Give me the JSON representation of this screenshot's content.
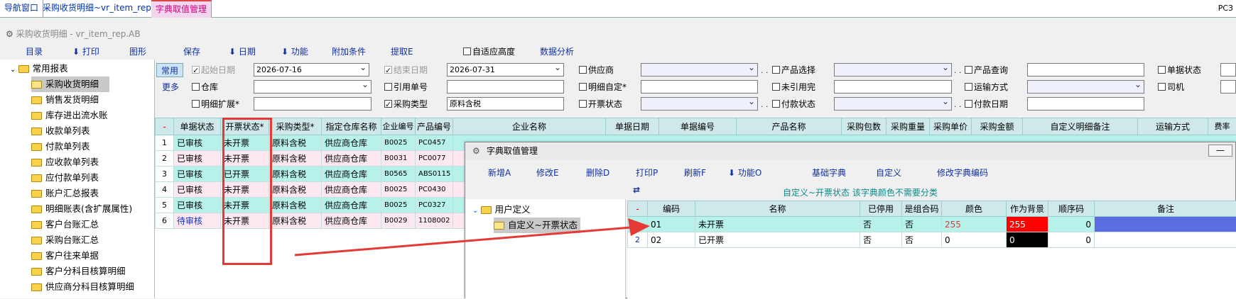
{
  "tabs": [
    {
      "label": "导航窗口"
    },
    {
      "label": "采购收货明细~vr_item_rep.AB"
    },
    {
      "label": "字典取值管理"
    }
  ],
  "pc_id": "PC3",
  "window_title": "采购收货明细 - vr_item_rep.AB",
  "menu": {
    "catalog": "目录",
    "print": "打印",
    "chart": "图形",
    "save": "保存",
    "date": "日期",
    "function": "功能",
    "extra_cond": "附加条件",
    "extract": "提取E",
    "auto_height": "自适应高度",
    "data_analysis": "数据分析"
  },
  "sidebar": {
    "root": "常用报表",
    "items": [
      "采购收货明细",
      "销售发货明细",
      "库存进出流水账",
      "收款单列表",
      "付款单列表",
      "应收款单列表",
      "应付款单列表",
      "账户汇总报表",
      "明细账表(含扩展属性)",
      "客户台账汇总",
      "采购台账汇总",
      "客户往来单据",
      "客户分科目核算明细",
      "供应商分科目核算明细"
    ]
  },
  "filters": {
    "tab_common": "常用",
    "tab_more": "更多",
    "start_date_label": "起始日期",
    "start_date_value": "2026-07-16",
    "end_date_label": "结束日期",
    "end_date_value": "2026-07-31",
    "supplier": "供应商",
    "product_select": "产品选择",
    "product_query": "产品查询",
    "doc_status": "单据状态",
    "warehouse": "仓库",
    "ref_no": "引用单号",
    "detail_custom": "明细自定*",
    "unquoted": "未引用完",
    "ship_method": "运输方式",
    "driver": "司机",
    "detail_ext": "明细扩展*",
    "purchase_type": "采购类型",
    "purchase_type_value": "原料含税",
    "invoice_status": "开票状态",
    "pay_status": "付款状态",
    "pay_date": "付款日期"
  },
  "grid": {
    "headers": [
      "单据状态",
      "开票状态*",
      "采购类型*",
      "指定仓库名称",
      "企业编号",
      "产品编号",
      "企业名称",
      "单据日期",
      "单据编号",
      "产品名称",
      "采购包数",
      "采购重量",
      "采购单价",
      "采购金额",
      "自定义明细备注",
      "运输方式",
      "费率"
    ],
    "rows": [
      [
        "1",
        "已审核",
        "未开票",
        "原料含税",
        "供应商仓库",
        "B0025",
        "PC0457"
      ],
      [
        "2",
        "已审核",
        "未开票",
        "原料含税",
        "供应商仓库",
        "B0031",
        "PC0077"
      ],
      [
        "3",
        "已审核",
        "已开票",
        "原料含税",
        "供应商仓库",
        "B0565",
        "ABS0115"
      ],
      [
        "4",
        "已审核",
        "未开票",
        "原料含税",
        "供应商仓库",
        "B0025",
        "PC0430"
      ],
      [
        "5",
        "已审核",
        "未开票",
        "原料含税",
        "供应商仓库",
        "B0025",
        "PC0327"
      ],
      [
        "6",
        "待审核",
        "未开票",
        "原料含税",
        "供应商仓库",
        "B0029",
        "1108002"
      ]
    ]
  },
  "dialog": {
    "title": "字典取值管理",
    "toolbar": [
      "新增A",
      "修改E",
      "删除D",
      "打印P",
      "刷新F",
      "功能O",
      "基础字典",
      "自定义",
      "修改字典编码"
    ],
    "info": "自定义~开票状态   该字典颜色不需要分类",
    "tree_root": "用户定义",
    "tree_child": "自定义~开票状态",
    "headers": [
      "编码",
      "名称",
      "已停用",
      "是组合码",
      "颜色",
      "作为背景",
      "顺序码",
      "备注"
    ],
    "rows": [
      {
        "rn": "",
        "code": "01",
        "name": "未开票",
        "disabled": "否",
        "combo": "否",
        "color": "255",
        "bg": "255",
        "order": "0"
      },
      {
        "rn": "2",
        "code": "02",
        "name": "已开票",
        "disabled": "否",
        "combo": "否",
        "color": "0",
        "bg": "0",
        "order": "0"
      }
    ]
  },
  "colors": {
    "highlight_red": "#e53935",
    "row_cyan": "#b7f2ea",
    "accent_blue": "#5b6ee0"
  }
}
